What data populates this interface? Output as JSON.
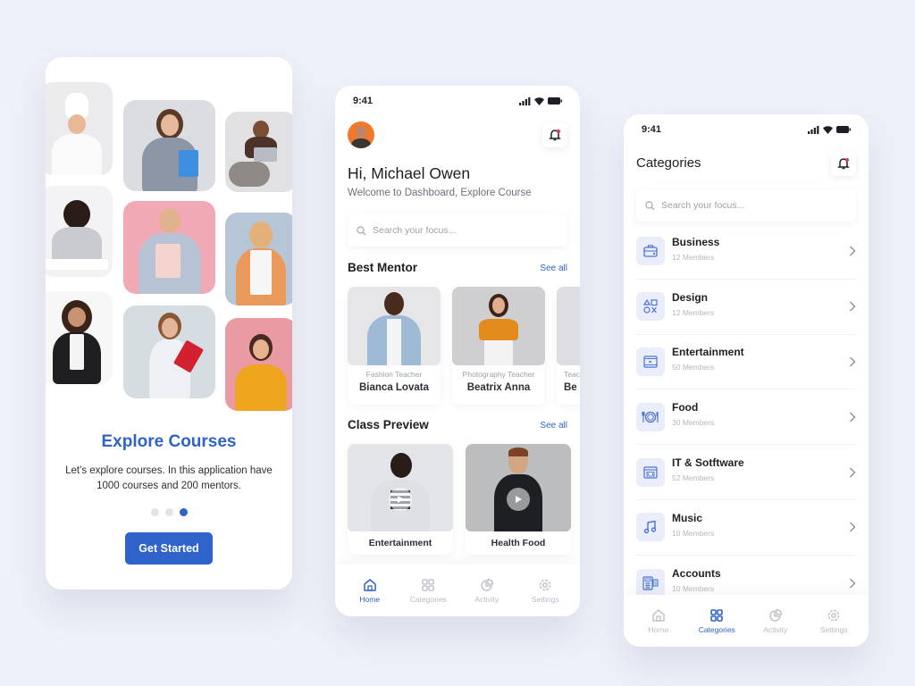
{
  "onboarding": {
    "title": "Explore Courses",
    "description": "Let's explore courses. In this application have 1000 courses and 200 mentors.",
    "pagination": {
      "total": 3,
      "active_index": 2
    },
    "cta_label": "Get Started",
    "photo_tiles": [
      "chef-thumbs-up",
      "woman-with-folders",
      "woman-on-beanbag-laptop",
      "woman-writing",
      "woman-pink-backpack",
      "woman-with-phone",
      "woman-arms-crossed",
      "woman-red-folder",
      "woman-headphones"
    ]
  },
  "dashboard": {
    "status_time": "9:41",
    "greeting": "Hi, Michael Owen",
    "subtitle": "Welcome to Dashboard, Explore Course",
    "search_placeholder": "Search your focus...",
    "best_mentor": {
      "title": "Best Mentor",
      "see_all": "See all",
      "mentors": [
        {
          "role": "Fashion Teacher",
          "name": "Bianca Lovata"
        },
        {
          "role": "Photography Teacher",
          "name": "Beatrix Anna"
        },
        {
          "role": "Teacher",
          "name": "Be"
        }
      ]
    },
    "class_preview": {
      "title": "Class Preview",
      "see_all": "See all",
      "classes": [
        {
          "label": "Entertainment"
        },
        {
          "label": "Health Food"
        }
      ]
    },
    "tabs": [
      {
        "label": "Home",
        "icon": "home-icon",
        "active": true
      },
      {
        "label": "Categories",
        "icon": "grid-icon",
        "active": false
      },
      {
        "label": "Activity",
        "icon": "pie-chart-icon",
        "active": false
      },
      {
        "label": "Settings",
        "icon": "gear-icon",
        "active": false
      }
    ]
  },
  "categories": {
    "status_time": "9:41",
    "title": "Categories",
    "search_placeholder": "Search your focus...",
    "items": [
      {
        "name": "Business",
        "members": "12 Members",
        "icon": "briefcase-icon"
      },
      {
        "name": "Design",
        "members": "12 Members",
        "icon": "shapes-icon"
      },
      {
        "name": "Entertainment",
        "members": "50 Members",
        "icon": "film-icon"
      },
      {
        "name": "Food",
        "members": "30 Members",
        "icon": "plate-cutlery-icon"
      },
      {
        "name": "IT & Sotftware",
        "members": "52 Members",
        "icon": "code-window-icon"
      },
      {
        "name": "Music",
        "members": "10 Members",
        "icon": "music-note-icon"
      },
      {
        "name": "Accounts",
        "members": "10 Members",
        "icon": "calculator-icon"
      }
    ],
    "tabs": [
      {
        "label": "Home",
        "icon": "home-icon",
        "active": false
      },
      {
        "label": "Categories",
        "icon": "grid-icon",
        "active": true
      },
      {
        "label": "Activity",
        "icon": "pie-chart-icon",
        "active": false
      },
      {
        "label": "Settings",
        "icon": "gear-icon",
        "active": false
      }
    ]
  },
  "colors": {
    "background": "#eef1f8",
    "accent": "#2f63c9",
    "notification_dot": "#e8334a",
    "icon_tile": "#eaeefa"
  }
}
